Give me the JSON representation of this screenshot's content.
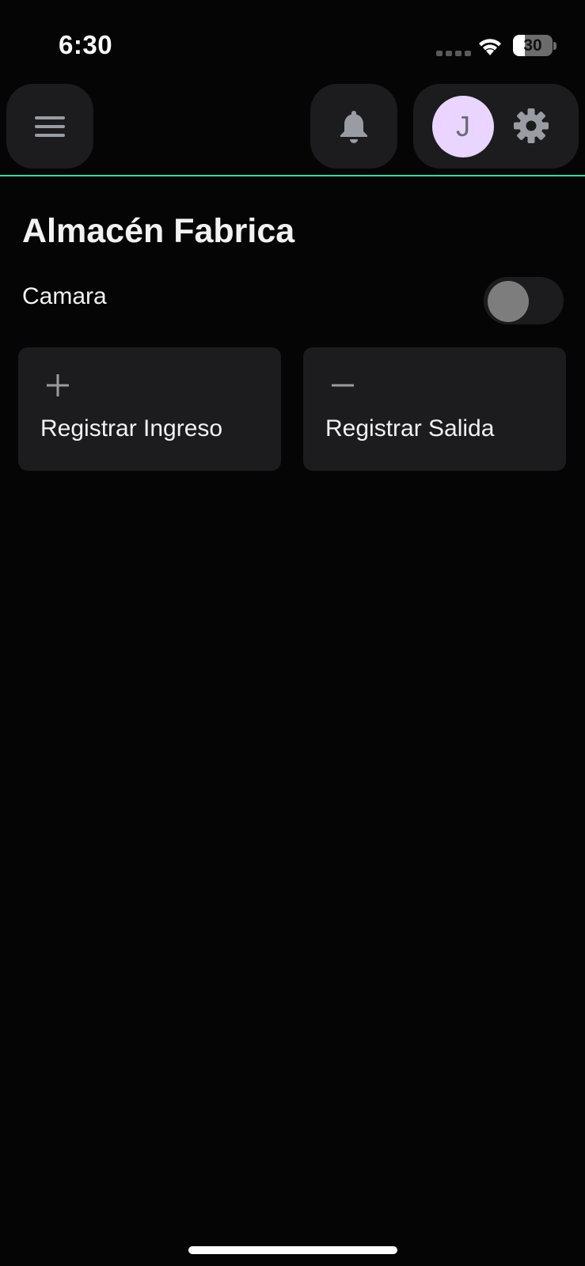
{
  "status_bar": {
    "time": "6:30",
    "battery_level": "30",
    "battery_fraction": 0.3,
    "signal_icon": "cellular-dots-icon",
    "wifi_icon": "wifi-icon"
  },
  "header": {
    "menu_icon": "hamburger-menu-icon",
    "notification_icon": "bell-icon",
    "avatar_initial": "J",
    "settings_icon": "gear-icon",
    "accent_color": "#3fd1a4",
    "avatar_color": "#e9d5ff"
  },
  "main": {
    "title": "Almacén Fabrica",
    "camera_toggle": {
      "label": "Camara",
      "enabled": false
    },
    "actions": [
      {
        "icon": "plus-icon",
        "label": "Registrar Ingreso"
      },
      {
        "icon": "minus-icon",
        "label": "Registrar Salida"
      }
    ]
  }
}
